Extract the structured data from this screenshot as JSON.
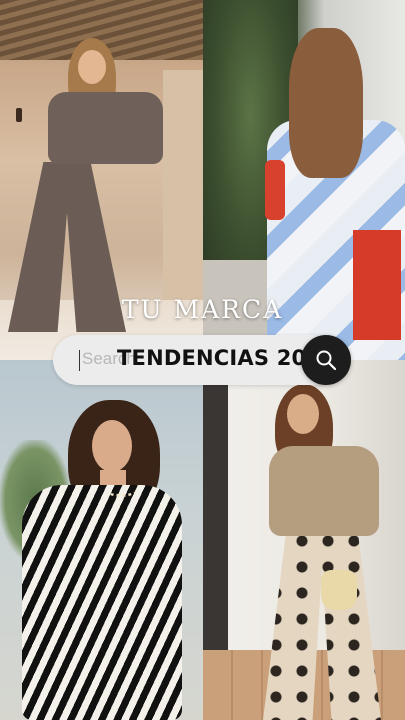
{
  "brand": {
    "name": "TU MARCA"
  },
  "search": {
    "placeholder": "Search",
    "query": "TENDENCIAS 2026",
    "button_icon": "search-icon"
  },
  "tiles": [
    {
      "icon": "photo-brown-outfit"
    },
    {
      "icon": "photo-printed-shirt"
    },
    {
      "icon": "photo-zebra-outfit"
    },
    {
      "icon": "photo-polka-dot-pants"
    }
  ],
  "colors": {
    "button": "#1d1d1d",
    "pill": "#ececec",
    "brand_text": "#ffffff"
  }
}
